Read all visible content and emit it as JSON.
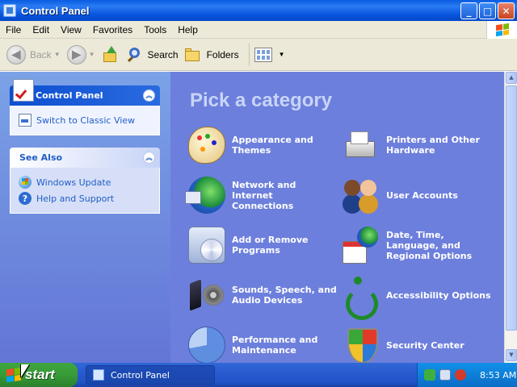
{
  "window": {
    "title": "Control Panel",
    "title_icon": "control-panel-icon"
  },
  "menu": [
    "File",
    "Edit",
    "View",
    "Favorites",
    "Tools",
    "Help"
  ],
  "toolbar": {
    "back_label": "Back",
    "search_label": "Search",
    "folders_label": "Folders"
  },
  "sidebar": {
    "control_panel": {
      "title": "Control Panel",
      "switch_label": "Switch to Classic View"
    },
    "see_also": {
      "title": "See Also",
      "links": [
        "Windows Update",
        "Help and Support"
      ]
    }
  },
  "main": {
    "heading": "Pick a category",
    "categories": [
      {
        "label": "Appearance and Themes",
        "icon": "palette-icon"
      },
      {
        "label": "Network and Internet Connections",
        "icon": "network-icon"
      },
      {
        "label": "Add or Remove Programs",
        "icon": "cd-box-icon"
      },
      {
        "label": "Sounds, Speech, and Audio Devices",
        "icon": "speaker-icon"
      },
      {
        "label": "Performance and Maintenance",
        "icon": "pie-chart-icon"
      },
      {
        "label": "Printers and Other Hardware",
        "icon": "printer-icon"
      },
      {
        "label": "User Accounts",
        "icon": "users-icon"
      },
      {
        "label": "Date, Time, Language, and Regional Options",
        "icon": "calendar-globe-icon"
      },
      {
        "label": "Accessibility Options",
        "icon": "accessibility-icon"
      },
      {
        "label": "Security Center",
        "icon": "shield-icon"
      }
    ]
  },
  "taskbar": {
    "start_label": "start",
    "task_label": "Control Panel",
    "clock": "8:53 AM"
  },
  "colors": {
    "title_bar": "#0a5ce0",
    "main_background": "#6d7fdc",
    "sidebar_background": "#7ba2e7",
    "start_button": "#379b37",
    "category_text": "#ffffff"
  }
}
